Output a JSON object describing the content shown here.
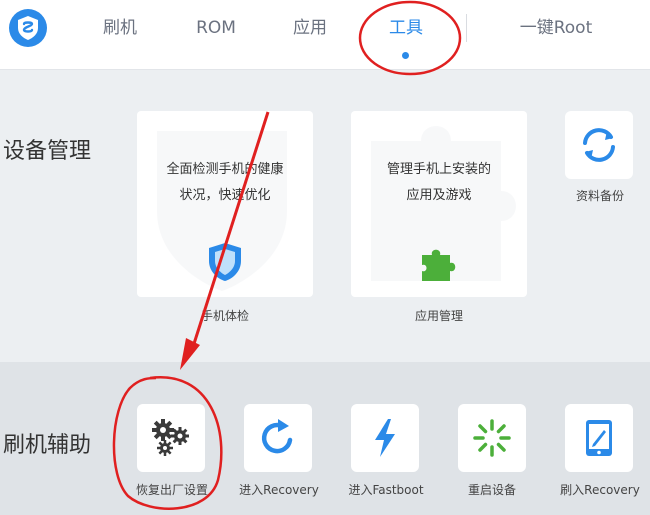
{
  "nav": {
    "tabs": [
      {
        "label": "刷机"
      },
      {
        "label": "ROM"
      },
      {
        "label": "应用"
      },
      {
        "label": "工具"
      },
      {
        "label": "一键Root"
      }
    ],
    "active_tab": "工具"
  },
  "device_section": {
    "title": "设备管理",
    "cards": [
      {
        "line1": "全面检测手机的健康",
        "line2": "状况，快速优化",
        "label": "手机体检",
        "icon": "shield-icon"
      },
      {
        "line1": "管理手机上安装的",
        "line2": "应用及游戏",
        "label": "应用管理",
        "icon": "puzzle-icon"
      },
      {
        "label": "资料备份",
        "icon": "sync-icon"
      }
    ]
  },
  "flash_section": {
    "title": "刷机辅助",
    "tools": [
      {
        "label": "恢复出厂设置",
        "icon": "gears-icon"
      },
      {
        "label": "进入Recovery",
        "icon": "refresh-icon"
      },
      {
        "label": "进入Fastboot",
        "icon": "lightning-icon"
      },
      {
        "label": "重启设备",
        "icon": "loading-icon"
      },
      {
        "label": "刷入Recovery",
        "icon": "tablet-edit-icon"
      }
    ]
  },
  "colors": {
    "accent": "#2b8ae8",
    "annotation_red": "#e02020",
    "puzzle_green": "#4caf3a"
  }
}
